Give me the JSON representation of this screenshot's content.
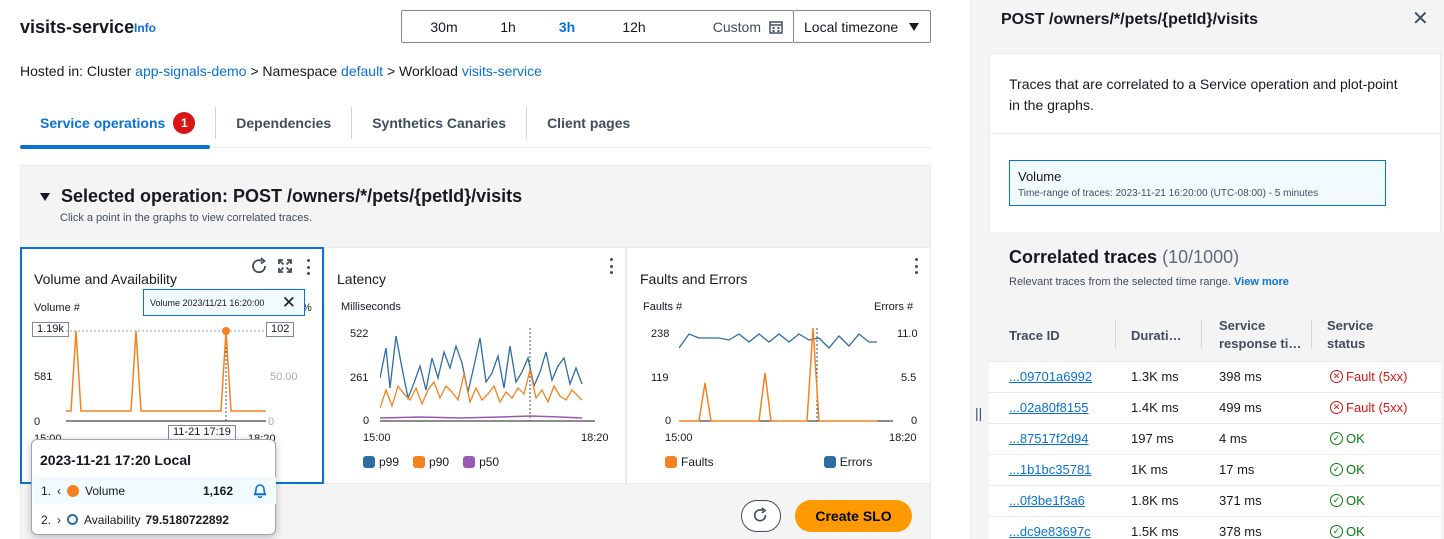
{
  "header": {
    "title": "visits-service",
    "info": "Info",
    "time_ranges": [
      {
        "label": "30m",
        "selected": false
      },
      {
        "label": "1h",
        "selected": false
      },
      {
        "label": "3h",
        "selected": true
      },
      {
        "label": "12h",
        "selected": false
      },
      {
        "label": "Custom",
        "selected": false
      }
    ],
    "timezone": "Local timezone"
  },
  "breadcrumb": {
    "prefix": "Hosted in: Cluster ",
    "cluster": "app-signals-demo",
    "sep1": " > Namespace ",
    "namespace": "default",
    "sep2": " > Workload ",
    "workload": "visits-service"
  },
  "tabs": [
    {
      "label": "Service operations",
      "badge": "1",
      "active": true
    },
    {
      "label": "Dependencies"
    },
    {
      "label": "Synthetics Canaries"
    },
    {
      "label": "Client pages"
    }
  ],
  "operation": {
    "title": "Selected operation: POST /owners/*/pets/{petId}/visits",
    "subtitle": "Click a point in the graphs to view correlated traces."
  },
  "cards": {
    "volume": {
      "title": "Volume and Availability",
      "left_axis": "Volume #",
      "right_axis_suffix": "%",
      "chip": "Volume 2023/11/21 16:20:00",
      "left_ticks": [
        "1.19k",
        "581",
        "0"
      ],
      "right_ticks": [
        "102",
        "50.00",
        "0"
      ],
      "x_ticks": [
        "15:00",
        "11-21 17:19",
        "18:20"
      ]
    },
    "latency": {
      "title": "Latency",
      "axis": "Milliseconds",
      "ticks": [
        "522",
        "261",
        "0"
      ],
      "x_ticks": [
        "15:00",
        "18:20"
      ],
      "legend": [
        "p99",
        "p90",
        "p50"
      ]
    },
    "faults": {
      "title": "Faults and Errors",
      "left_axis": "Faults #",
      "right_axis": "Errors #",
      "left_ticks": [
        "238",
        "119",
        "0"
      ],
      "right_ticks": [
        "11.0",
        "5.5",
        "0"
      ],
      "x_ticks": [
        "15:00",
        "18:20"
      ],
      "legend": [
        "Faults",
        "Errors"
      ]
    }
  },
  "popup": {
    "title": "2023-11-21 17:20 Local",
    "row1_index": "1.",
    "row1_label": "Volume",
    "row1_value": "1,162",
    "row2_index": "2.",
    "row2_label": "Availability",
    "row2_value": "79.5180722892"
  },
  "actions": {
    "create_slo": "Create SLO"
  },
  "colors": {
    "orange": "#ff9900",
    "series_orange": "#f5821f",
    "blue": "#2e6da4",
    "purple": "#9b59b6",
    "link": "#0972d3",
    "fault_red": "#d91515",
    "ok_green": "#037f0c"
  },
  "drawer": {
    "title": "POST /owners/*/pets/{petId}/visits",
    "description": "Traces that are correlated to a Service operation and plot-point in the graphs.",
    "volume_label": "Volume",
    "time_range_text": "Time-range of traces: 2023-11-21 16:20:00 (UTC-08:00) - 5 minutes",
    "correlated_title": "Correlated traces",
    "correlated_count": "(10/1000)",
    "correlated_sub": "Relevant traces from the selected time range.",
    "view_more": "View more",
    "columns": {
      "trace_id": "Trace ID",
      "duration": "Durati…",
      "response_1": "Service",
      "response_2": "response ti…",
      "status_1": "Service",
      "status_2": "status"
    },
    "rows": [
      {
        "trace": "...09701a6992",
        "duration": "1.3K ms",
        "response": "398 ms",
        "status": "Fault (5xx)",
        "kind": "fault"
      },
      {
        "trace": "...02a80f8155",
        "duration": "1.4K ms",
        "response": "499 ms",
        "status": "Fault (5xx)",
        "kind": "fault"
      },
      {
        "trace": "...87517f2d94",
        "duration": "197 ms",
        "response": "4 ms",
        "status": "OK",
        "kind": "ok"
      },
      {
        "trace": "...1b1bc35781",
        "duration": "1K ms",
        "response": "17 ms",
        "status": "OK",
        "kind": "ok"
      },
      {
        "trace": "...0f3be1f3a6",
        "duration": "1.8K ms",
        "response": "371 ms",
        "status": "OK",
        "kind": "ok"
      },
      {
        "trace": "...dc9e83697c",
        "duration": "1.5K ms",
        "response": "378 ms",
        "status": "OK",
        "kind": "ok"
      }
    ]
  }
}
